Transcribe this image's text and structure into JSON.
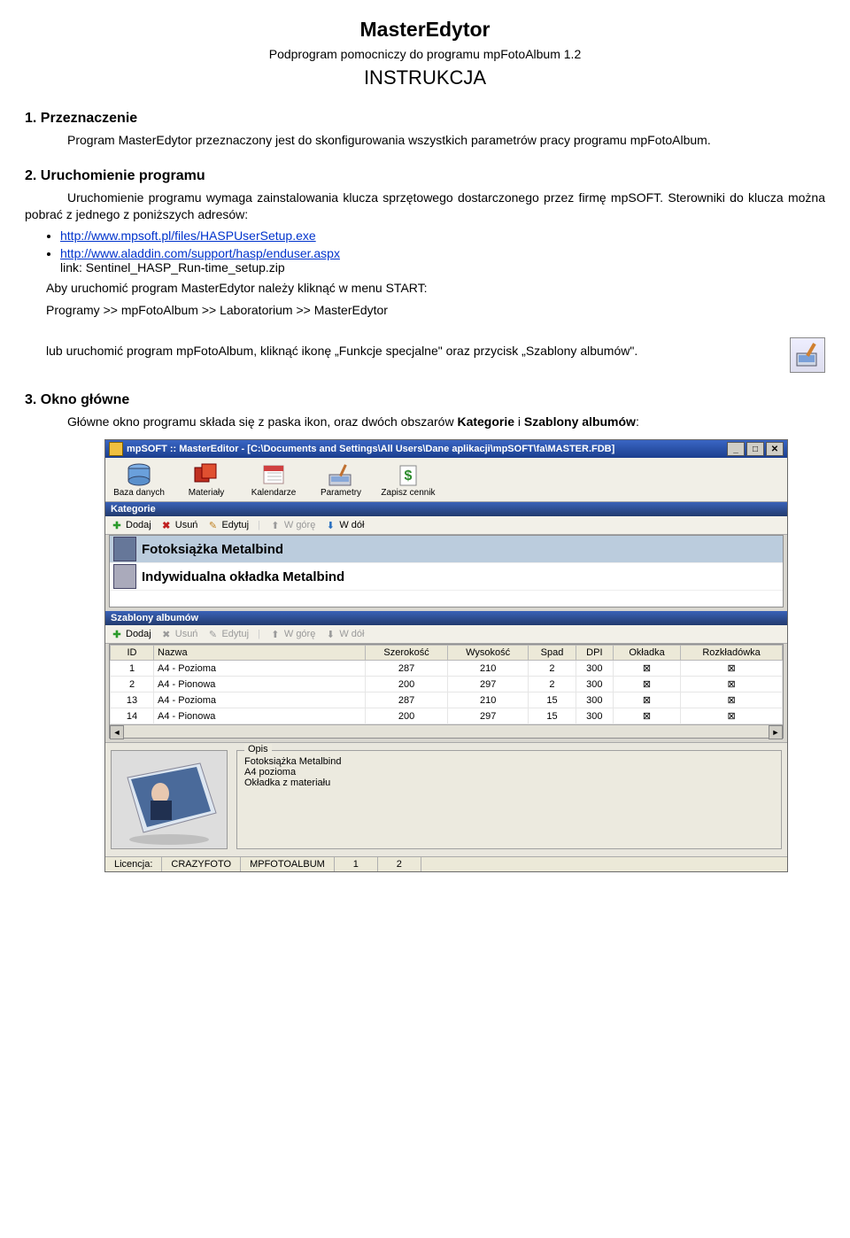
{
  "doc": {
    "title": "MasterEdytor",
    "subtitle": "Podprogram pomocniczy do programu mpFotoAlbum 1.2",
    "instr": "INSTRUKCJA"
  },
  "s1": {
    "head": "1.  Przeznaczenie",
    "body": "Program MasterEdytor przeznaczony jest do skonfigurowania wszystkich parametrów pracy programu mpFotoAlbum."
  },
  "s2": {
    "head": "2.  Uruchomienie programu",
    "intro": "Uruchomienie programu wymaga zainstalowania klucza sprzętowego dostarczonego przez firmę mpSOFT. Sterowniki do klucza można pobrać z jednego z poniższych adresów:",
    "link1": "http://www.mpsoft.pl/files/HASPUserSetup.exe",
    "link2a": "http://www.aladdin.com/support/hasp/enduser.aspx",
    "link2b": "link: Sentinel_HASP_Run-time_setup.zip",
    "after1": "Aby uruchomić program MasterEdytor należy kliknąć w menu START:",
    "after2": "Programy >> mpFotoAlbum >> Laboratorium >> MasterEdytor",
    "after3": "lub uruchomić program mpFotoAlbum, kliknąć ikonę „Funkcje specjalne\"  oraz przycisk „Szablony albumów\"."
  },
  "s3": {
    "head": "3.  Okno główne",
    "body_a": "Główne okno programu składa się z paska ikon, oraz dwóch obszarów ",
    "body_b": "Kategorie",
    "body_c": " i ",
    "body_d": "Szablony albumów",
    "body_e": ":"
  },
  "win": {
    "title": "mpSOFT :: MasterEditor  -  [C:\\Documents and Settings\\All Users\\Dane aplikacji\\mpSOFT\\fa\\MASTER.FDB]",
    "toolbar": [
      {
        "label": "Baza danych"
      },
      {
        "label": "Materiały"
      },
      {
        "label": "Kalendarze"
      },
      {
        "label": "Parametry"
      },
      {
        "label": "Zapisz cennik"
      }
    ],
    "actions": {
      "add": "Dodaj",
      "del": "Usuń",
      "edit": "Edytuj",
      "up": "W górę",
      "down": "W dół"
    },
    "cat": {
      "title": "Kategorie",
      "items": [
        "Fotoksiążka Metalbind",
        "Indywidualna okładka Metalbind"
      ]
    },
    "templ": {
      "title": "Szablony albumów",
      "cols": [
        "ID",
        "Nazwa",
        "Szerokość",
        "Wysokość",
        "Spad",
        "DPI",
        "Okładka",
        "Rozkładówka"
      ],
      "rows": [
        {
          "id": "1",
          "name": "A4 - Pozioma",
          "w": "287",
          "h": "210",
          "s": "2",
          "dpi": "300",
          "ok": "⊠",
          "rk": "⊠"
        },
        {
          "id": "2",
          "name": "A4 - Pionowa",
          "w": "200",
          "h": "297",
          "s": "2",
          "dpi": "300",
          "ok": "⊠",
          "rk": "⊠"
        },
        {
          "id": "13",
          "name": "A4 - Pozioma",
          "w": "287",
          "h": "210",
          "s": "15",
          "dpi": "300",
          "ok": "⊠",
          "rk": "⊠"
        },
        {
          "id": "14",
          "name": "A4 - Pionowa",
          "w": "200",
          "h": "297",
          "s": "15",
          "dpi": "300",
          "ok": "⊠",
          "rk": "⊠"
        }
      ]
    },
    "desc": {
      "legend": "Opis",
      "l1": "Fotoksiążka Metalbind",
      "l2": "A4 pozioma",
      "l3": "Okładka z materiału"
    },
    "status": {
      "label": "Licencja:",
      "v1": "CRAZYFOTO",
      "v2": "MPFOTOALBUM",
      "v3": "1",
      "v4": "2"
    }
  }
}
